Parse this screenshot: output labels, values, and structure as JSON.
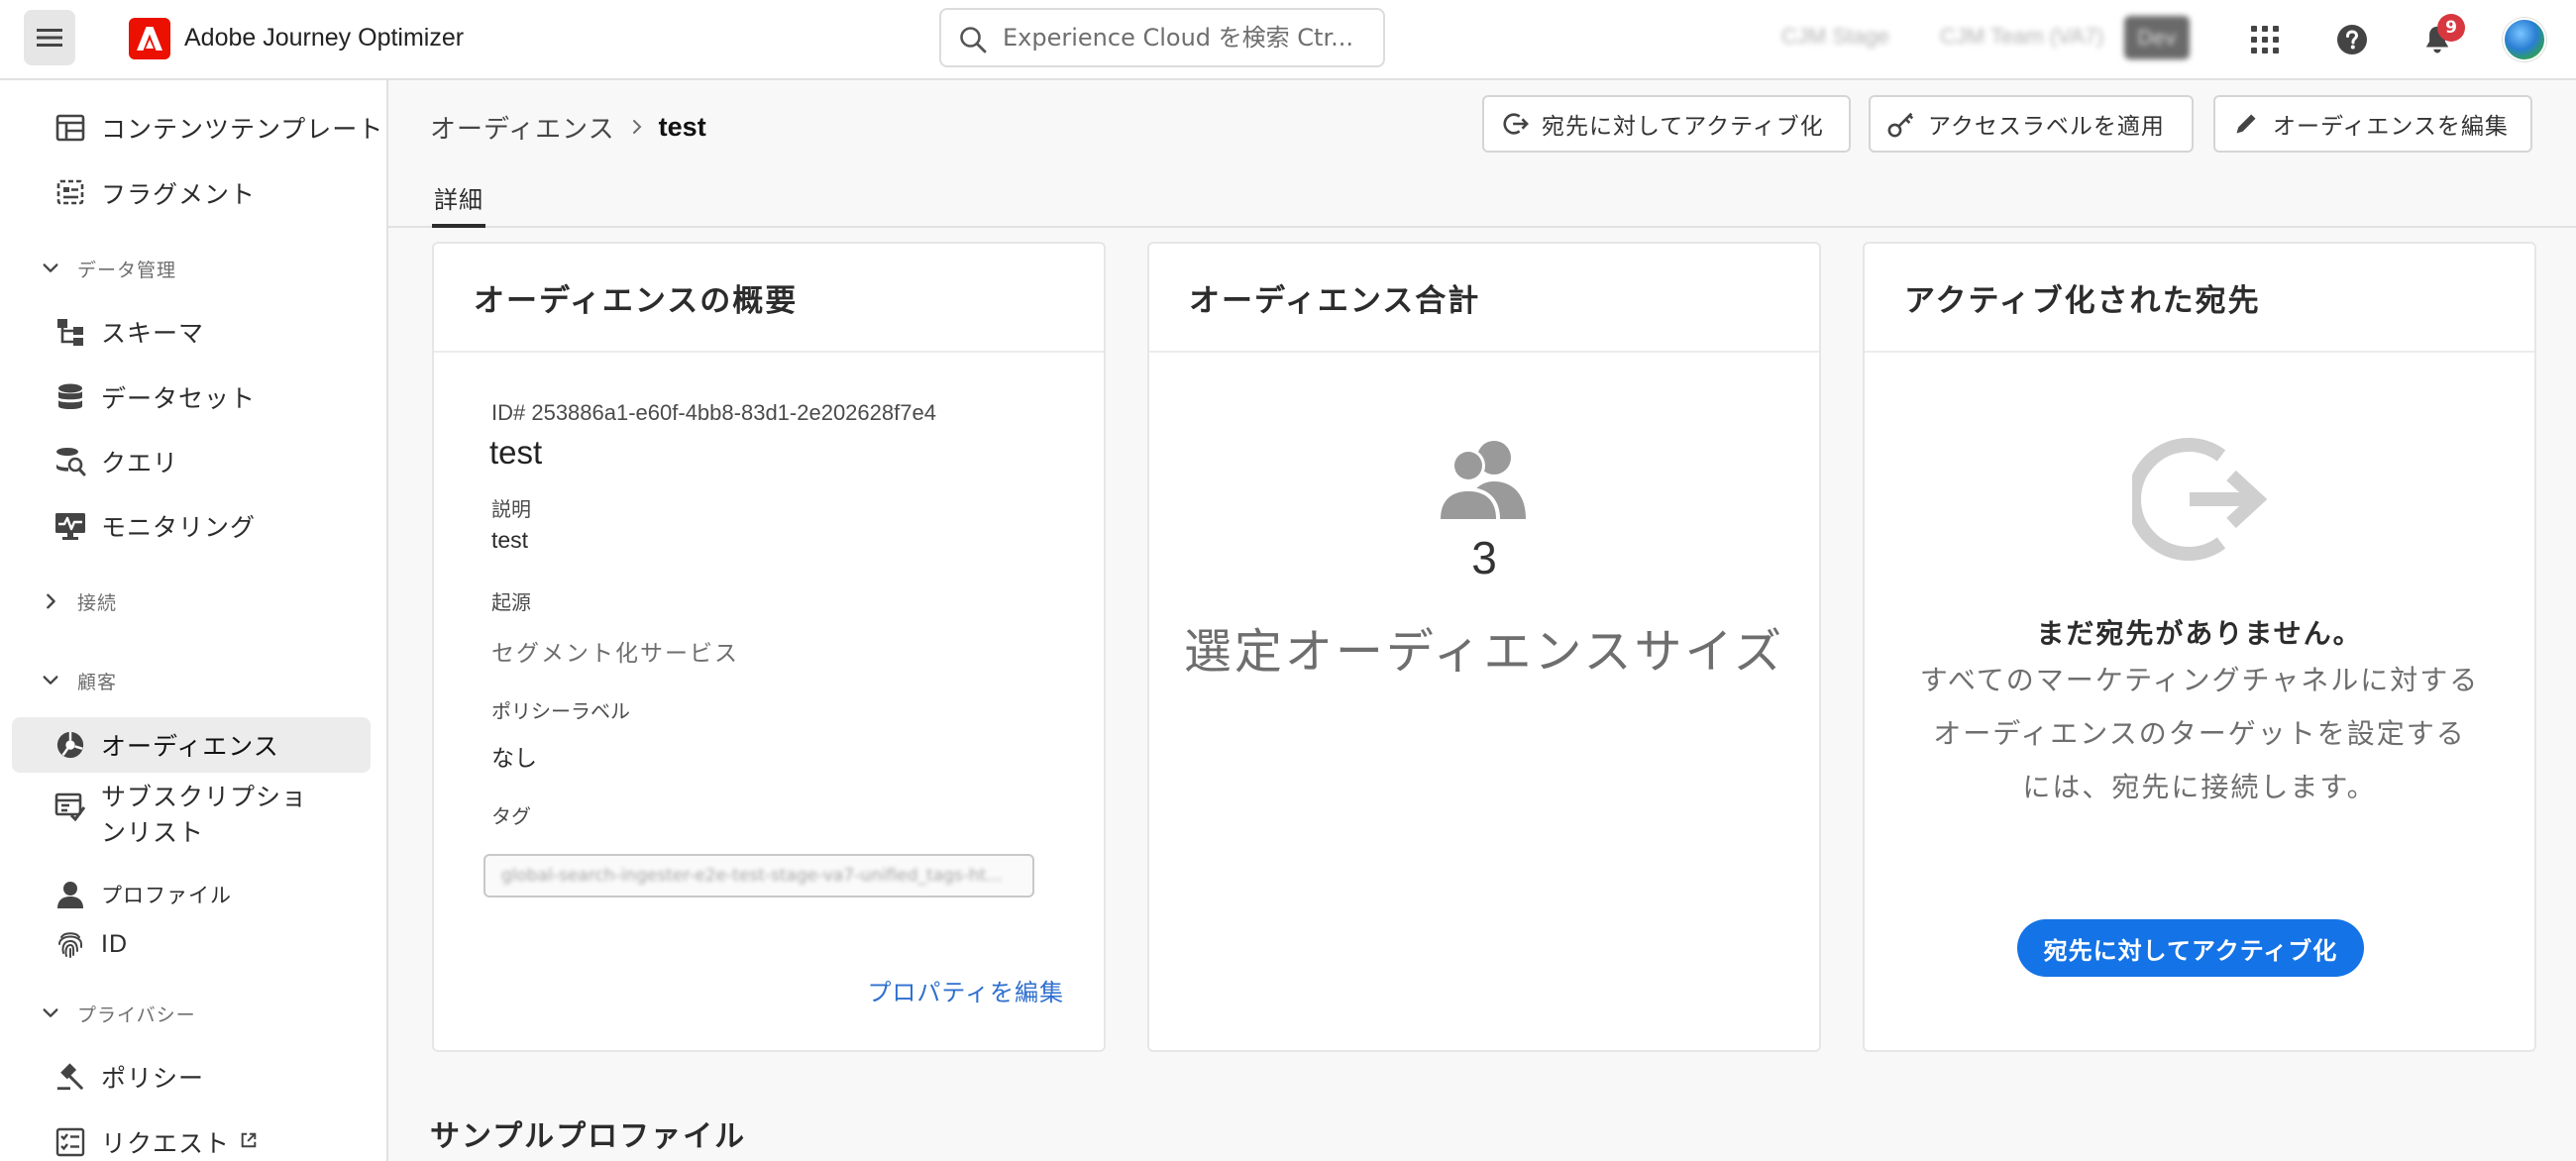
{
  "header": {
    "app_title": "Adobe Journey Optimizer",
    "search_placeholder": "Experience Cloud を検索 Ctr...",
    "org_stage": "CJM Stage",
    "org_team": "CJM Team (VA7)",
    "env_badge": "Dev",
    "notification_count": "9"
  },
  "sidebar": {
    "content_templates": "コンテンツテンプレート",
    "fragments": "フラグメント",
    "group_data_management": "データ管理",
    "schemas": "スキーマ",
    "datasets": "データセット",
    "queries": "クエリ",
    "monitoring": "モニタリング",
    "group_connections": "接続",
    "group_customer": "顧客",
    "audiences": "オーディエンス",
    "subscription_lists": "サブスクリプションリスト",
    "profiles": "プロファイル",
    "identities": "ID",
    "group_privacy": "プライバシー",
    "policies": "ポリシー",
    "requests": "リクエスト"
  },
  "breadcrumb": {
    "parent": "オーディエンス",
    "current": "test"
  },
  "actions": {
    "activate": "宛先に対してアクティブ化",
    "access_labels": "アクセスラベルを適用",
    "edit_audience": "オーディエンスを編集"
  },
  "tabs": {
    "details": "詳細"
  },
  "overview": {
    "title": "オーディエンスの概要",
    "id": "ID# 253886a1-e60f-4bb8-83d1-2e202628f7e4",
    "name": "test",
    "description_label": "説明",
    "description_value": "test",
    "origin_label": "起源",
    "origin_value": "セグメント化サービス",
    "policy_label": "ポリシーラベル",
    "policy_value": "なし",
    "tags_label": "タグ",
    "tags_value": "global-search-ingester-e2e-test-stage-va7-unified_tags-ht...",
    "edit_properties": "プロパティを編集"
  },
  "total": {
    "title": "オーディエンス合計",
    "count": "3",
    "label": "選定オーディエンスサイズ"
  },
  "destinations": {
    "title": "アクティブ化された宛先",
    "empty_title": "まだ宛先がありません。",
    "desc_line1": "すべてのマーケティングチャネルに対する",
    "desc_line2": "オーディエンスのターゲットを設定する",
    "desc_line3": "には、宛先に接続します。",
    "cta": "宛先に対してアクティブ化"
  },
  "sample_profiles": {
    "title": "サンプルプロファイル"
  }
}
